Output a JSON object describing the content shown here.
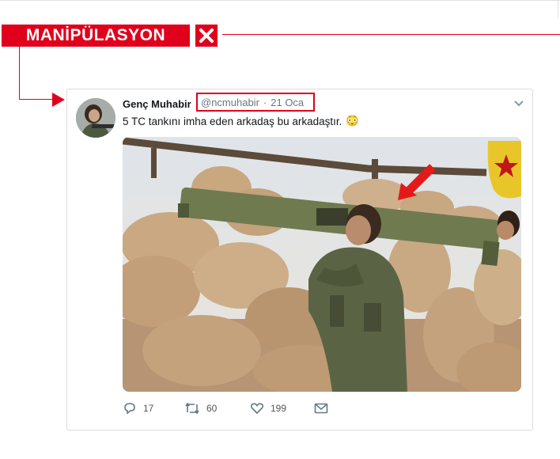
{
  "banner": {
    "label": "MANİPÜLASYON",
    "close_icon": "x-icon"
  },
  "colors": {
    "accent": "#e0001b",
    "meta": "#657786"
  },
  "tweet": {
    "author": "Genç Muhabir",
    "handle": "@ncmuhabir",
    "separator": "·",
    "date": "21 Oca",
    "text": "5 TC tankını imha eden arkadaş bu arkadaştır.",
    "emoji": "😳",
    "stats": {
      "replies": "17",
      "retweets": "60",
      "likes": "199"
    },
    "icons": [
      "reply-icon",
      "retweet-icon",
      "like-icon",
      "dm-icon",
      "chevron-down-icon"
    ]
  }
}
